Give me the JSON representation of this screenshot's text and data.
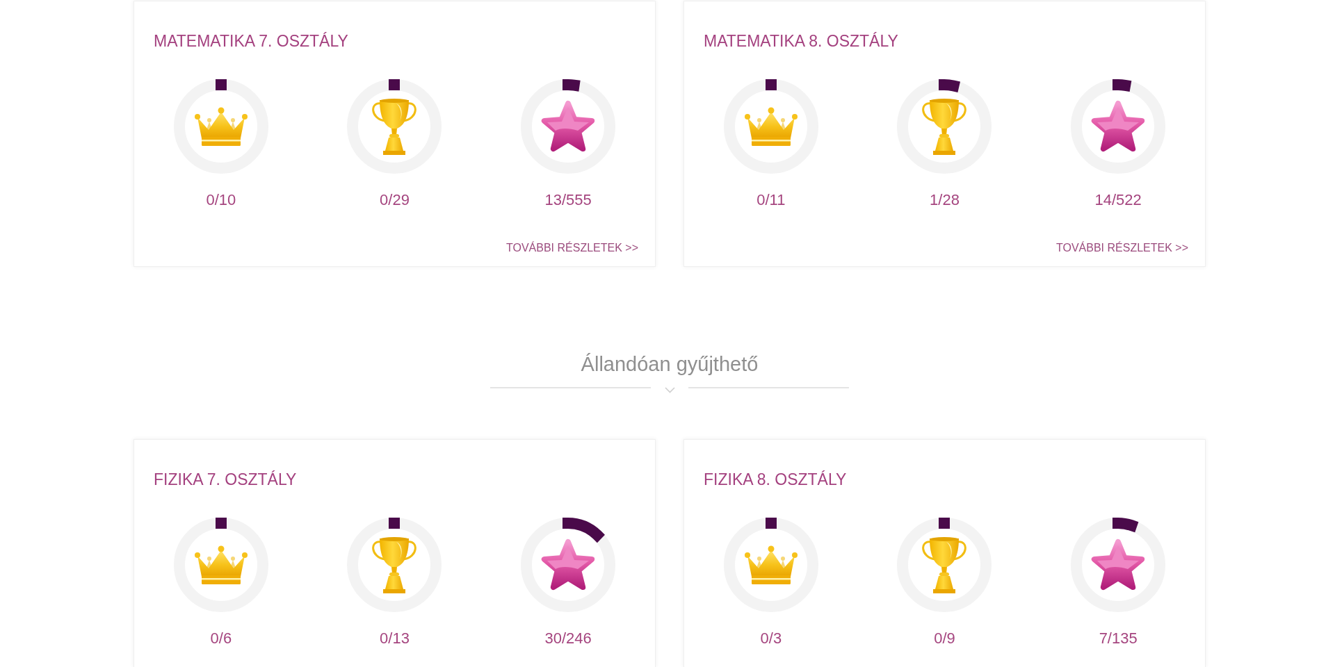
{
  "sections": [
    {
      "cards": [
        {
          "title": "MATEMATIKA 7. OSZTÁLY",
          "stats": [
            {
              "kind": "crown",
              "count": "0/10",
              "level": 0
            },
            {
              "kind": "trophy",
              "count": "0/29",
              "level": 0
            },
            {
              "kind": "star",
              "count": "13/555",
              "level": 0.023
            }
          ],
          "link": "TOVÁBBI RÉSZLETEK >>"
        },
        {
          "title": "MATEMATIKA 8. OSZTÁLY",
          "stats": [
            {
              "kind": "crown",
              "count": "0/11",
              "level": 0
            },
            {
              "kind": "trophy",
              "count": "1/28",
              "level": 0.036
            },
            {
              "kind": "star",
              "count": "14/522",
              "level": 0.027
            }
          ],
          "link": "TOVÁBBI RÉSZLETEK >>"
        }
      ]
    },
    {
      "heading": "Állandóan gyűjthető",
      "cards": [
        {
          "title": "FIZIKA 7. OSZTÁLY",
          "stats": [
            {
              "kind": "crown",
              "count": "0/6",
              "level": 0
            },
            {
              "kind": "trophy",
              "count": "0/13",
              "level": 0
            },
            {
              "kind": "star",
              "count": "30/246",
              "level": 0.122
            }
          ]
        },
        {
          "title": "FIZIKA 8. OSZTÁLY",
          "stats": [
            {
              "kind": "crown",
              "count": "0/3",
              "level": 0
            },
            {
              "kind": "trophy",
              "count": "0/9",
              "level": 0
            },
            {
              "kind": "star",
              "count": "7/135",
              "level": 0.052
            }
          ]
        }
      ]
    }
  ]
}
